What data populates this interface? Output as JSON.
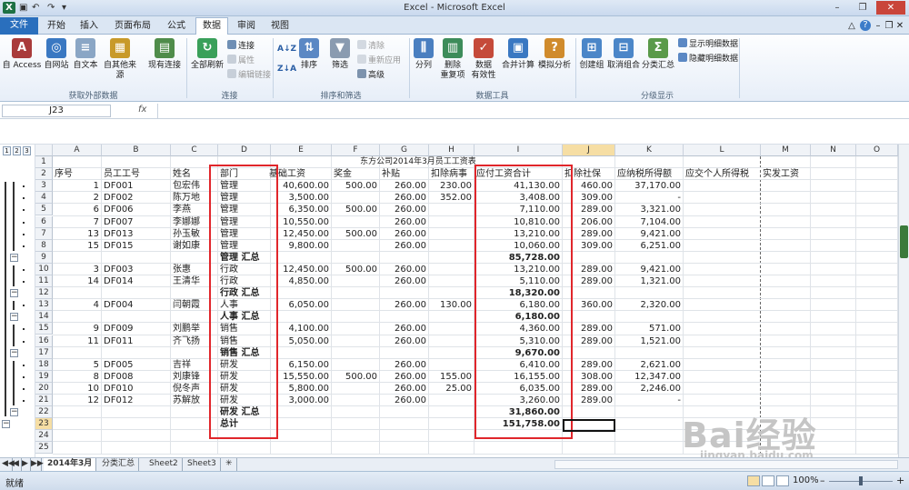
{
  "window": {
    "title": "Excel  -  Microsoft Excel",
    "minimize": "–",
    "restore": "❐",
    "close": "✕",
    "wb_minimize": "–",
    "wb_restore": "❐",
    "wb_close": "✕",
    "help": "?",
    "ribbon_toggle": "△"
  },
  "quick_access": {
    "app_icon": "X",
    "save": "▣",
    "undo": "↶",
    "redo": "↷",
    "customize": "▾"
  },
  "tabs": [
    "文件",
    "开始",
    "插入",
    "页面布局",
    "公式",
    "数据",
    "审阅",
    "视图"
  ],
  "ribbon": {
    "groups": {
      "external": "获取外部数据",
      "connections": "连接",
      "sort_filter": "排序和筛选",
      "data_tools": "数据工具",
      "outline": "分级显示"
    },
    "buttons": {
      "access": "自 Access",
      "web": "自网站",
      "text": "自文本",
      "other": "自其他来源",
      "existing": "现有连接",
      "refresh": "全部刷新",
      "connections": "连接",
      "properties": "属性",
      "edit_links": "编辑链接",
      "sort_az": "A↓Z",
      "sort_za": "Z↓A",
      "sort": "排序",
      "filter": "筛选",
      "clear": "清除",
      "reapply": "重新应用",
      "advanced": "高级",
      "split": "分列",
      "remove_dup": "删除\n重复项",
      "validation": "数据\n有效性",
      "consolidate": "合并计算",
      "whatif": "模拟分析",
      "group": "创建组",
      "ungroup": "取消组合",
      "subtotal": "分类汇总",
      "show_detail": "显示明细数据",
      "hide_detail": "隐藏明细数据"
    }
  },
  "formula_bar": {
    "name_box": "J23",
    "fx": "fx",
    "formula": ""
  },
  "outline_levels": [
    "1",
    "2",
    "3"
  ],
  "columns": [
    "A",
    "B",
    "C",
    "D",
    "E",
    "F",
    "G",
    "H",
    "I",
    "J",
    "K",
    "L",
    "M",
    "N",
    "O"
  ],
  "selected": {
    "column": "J",
    "row": "23"
  },
  "rows": [
    {
      "n": "1",
      "c": {
        "G": "东方公司2014年3月员工工资表"
      }
    },
    {
      "n": "2",
      "c": {
        "A": "序号",
        "B": "员工工号",
        "C": "姓名",
        "D": "部门",
        "E": "基础工资",
        "F": "奖金",
        "G": "补贴",
        "H": "扣除病事",
        "I": "应付工资合计",
        "J": "扣除社保",
        "K": "应纳税所得额",
        "L": "应交个人所得税",
        "M": "实发工资"
      }
    },
    {
      "n": "3",
      "c": {
        "A": "1",
        "B": "DF001",
        "C": "包宏伟",
        "D": "管理",
        "E": "40,600.00",
        "F": "500.00",
        "G": "260.00",
        "H": "230.00",
        "I": "41,130.00",
        "J": "460.00",
        "K": "37,170.00"
      }
    },
    {
      "n": "4",
      "c": {
        "A": "2",
        "B": "DF002",
        "C": "陈万地",
        "D": "管理",
        "E": "3,500.00",
        "G": "260.00",
        "H": "352.00",
        "I": "3,408.00",
        "J": "309.00",
        "K": "-"
      }
    },
    {
      "n": "5",
      "c": {
        "A": "6",
        "B": "DF006",
        "C": "李燕",
        "D": "管理",
        "E": "6,350.00",
        "F": "500.00",
        "G": "260.00",
        "I": "7,110.00",
        "J": "289.00",
        "K": "3,321.00"
      }
    },
    {
      "n": "6",
      "c": {
        "A": "7",
        "B": "DF007",
        "C": "李娜娜",
        "D": "管理",
        "E": "10,550.00",
        "G": "260.00",
        "I": "10,810.00",
        "J": "206.00",
        "K": "7,104.00"
      }
    },
    {
      "n": "7",
      "c": {
        "A": "13",
        "B": "DF013",
        "C": "孙玉敏",
        "D": "管理",
        "E": "12,450.00",
        "F": "500.00",
        "G": "260.00",
        "I": "13,210.00",
        "J": "289.00",
        "K": "9,421.00"
      }
    },
    {
      "n": "8",
      "c": {
        "A": "15",
        "B": "DF015",
        "C": "谢如康",
        "D": "管理",
        "E": "9,800.00",
        "G": "260.00",
        "I": "10,060.00",
        "J": "309.00",
        "K": "6,251.00"
      }
    },
    {
      "n": "9",
      "bold": true,
      "c": {
        "D": "管理 汇总",
        "I": "85,728.00"
      }
    },
    {
      "n": "10",
      "c": {
        "A": "3",
        "B": "DF003",
        "C": "张惠",
        "D": "行政",
        "E": "12,450.00",
        "F": "500.00",
        "G": "260.00",
        "I": "13,210.00",
        "J": "289.00",
        "K": "9,421.00"
      }
    },
    {
      "n": "11",
      "c": {
        "A": "14",
        "B": "DF014",
        "C": "王清华",
        "D": "行政",
        "E": "4,850.00",
        "G": "260.00",
        "I": "5,110.00",
        "J": "289.00",
        "K": "1,321.00"
      }
    },
    {
      "n": "12",
      "bold": true,
      "c": {
        "D": "行政 汇总",
        "I": "18,320.00"
      }
    },
    {
      "n": "13",
      "c": {
        "A": "4",
        "B": "DF004",
        "C": "闫朝霞",
        "D": "人事",
        "E": "6,050.00",
        "G": "260.00",
        "H": "130.00",
        "I": "6,180.00",
        "J": "360.00",
        "K": "2,320.00"
      }
    },
    {
      "n": "14",
      "bold": true,
      "c": {
        "D": "人事 汇总",
        "I": "6,180.00"
      }
    },
    {
      "n": "15",
      "c": {
        "A": "9",
        "B": "DF009",
        "C": "刘鹏举",
        "D": "销售",
        "E": "4,100.00",
        "G": "260.00",
        "I": "4,360.00",
        "J": "289.00",
        "K": "571.00"
      }
    },
    {
      "n": "16",
      "c": {
        "A": "11",
        "B": "DF011",
        "C": "齐飞扬",
        "D": "销售",
        "E": "5,050.00",
        "G": "260.00",
        "I": "5,310.00",
        "J": "289.00",
        "K": "1,521.00"
      }
    },
    {
      "n": "17",
      "bold": true,
      "c": {
        "D": "销售 汇总",
        "I": "9,670.00"
      }
    },
    {
      "n": "18",
      "c": {
        "A": "5",
        "B": "DF005",
        "C": "吉祥",
        "D": "研发",
        "E": "6,150.00",
        "G": "260.00",
        "I": "6,410.00",
        "J": "289.00",
        "K": "2,621.00"
      }
    },
    {
      "n": "19",
      "c": {
        "A": "8",
        "B": "DF008",
        "C": "刘康锋",
        "D": "研发",
        "E": "15,550.00",
        "F": "500.00",
        "G": "260.00",
        "H": "155.00",
        "I": "16,155.00",
        "J": "308.00",
        "K": "12,347.00"
      }
    },
    {
      "n": "20",
      "c": {
        "A": "10",
        "B": "DF010",
        "C": "倪冬声",
        "D": "研发",
        "E": "5,800.00",
        "G": "260.00",
        "H": "25.00",
        "I": "6,035.00",
        "J": "289.00",
        "K": "2,246.00"
      }
    },
    {
      "n": "21",
      "c": {
        "A": "12",
        "B": "DF012",
        "C": "苏解放",
        "D": "研发",
        "E": "3,000.00",
        "G": "260.00",
        "I": "3,260.00",
        "J": "289.00",
        "K": "-"
      }
    },
    {
      "n": "22",
      "bold": true,
      "c": {
        "D": "研发 汇总",
        "I": "31,860.00"
      }
    },
    {
      "n": "23",
      "bold": true,
      "c": {
        "D": "总计",
        "I": "151,758.00"
      }
    },
    {
      "n": "24",
      "c": {}
    },
    {
      "n": "25",
      "c": {}
    }
  ],
  "sheet_tabs": [
    "2014年3月",
    "分类汇总",
    "Sheet2",
    "Sheet3"
  ],
  "sheet_nav": [
    "◀◀",
    "◀",
    "▶",
    "▶▶"
  ],
  "new_sheet": "✳",
  "status": {
    "ready": "就绪",
    "zoom": "100%",
    "zoom_minus": "–",
    "zoom_plus": "+"
  },
  "watermark": {
    "brand": "Bai经验",
    "url": "jingyan.baidu.com"
  },
  "colors": {
    "accent": "#2a6fbd",
    "highlight": "#e0262b",
    "selection": "#f6dea4"
  }
}
